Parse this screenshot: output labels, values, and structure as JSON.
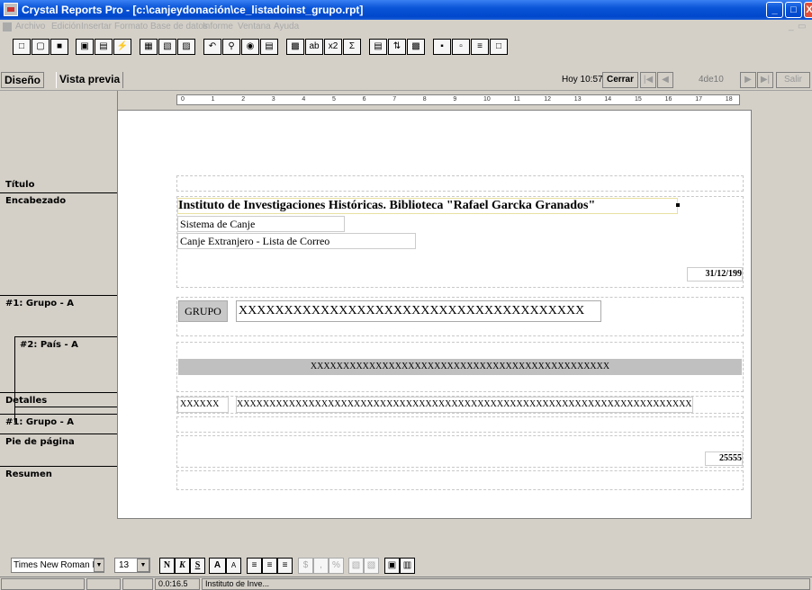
{
  "window": {
    "title": "Crystal Reports Pro - [c:\\canjeydonación\\ce_listadoinst_grupo.rpt]"
  },
  "menu": [
    "Archivo",
    "Edición",
    "Insertar",
    "Formato",
    "Base de datos",
    "Informe",
    "Ventana",
    "Ayuda"
  ],
  "tabs": {
    "design": "Diseño",
    "preview": "Vista previa"
  },
  "nav": {
    "today": "Hoy 10:57",
    "close": "Cerrar",
    "page": "4de10",
    "exit": "Salir"
  },
  "ruler": [
    "0",
    "1",
    "2",
    "3",
    "4",
    "5",
    "6",
    "7",
    "8",
    "9",
    "10",
    "11",
    "12",
    "13",
    "14",
    "15",
    "16",
    "17",
    "18"
  ],
  "sections": {
    "title": "Título",
    "header": "Encabezado",
    "group1": "#1: Grupo - A",
    "group2": "#2: País - A",
    "details": "Detalles",
    "group1_footer": "#1: Grupo - A",
    "footer": "Pie de página",
    "summary": "Resumen"
  },
  "report": {
    "heading": "Instituto de Investigaciones Históricas. Biblioteca \"Rafael Garcka Granados\"",
    "system": "Sistema de Canje",
    "subtitle": "Canje Extranjero - Lista de Correo",
    "date": "31/12/199",
    "group_label": "GRUPO",
    "group_field": "XXXXXXXXXXXXXXXXXXXXXXXXXXXXXXXXXXXXXX",
    "country_field": "XXXXXXXXXXXXXXXXXXXXXXXXXXXXXXXXXXXXXXXXXXXXXX",
    "detail_code": "XXXXXX",
    "detail_field": "XXXXXXXXXXXXXXXXXXXXXXXXXXXXXXXXXXXXXXXXXXXXXXXXXXXXXXXXXXXXXXXXXXXXXXXXXXXXXXXXXXXXXXXXXXXXXXX",
    "page_number": "25555"
  },
  "format": {
    "font": "Times New Roman I",
    "size": "13",
    "bold": "N",
    "italic": "K",
    "underline": "S"
  },
  "status": {
    "position": "0.0:16.5",
    "field": "Instituto de Inve..."
  }
}
